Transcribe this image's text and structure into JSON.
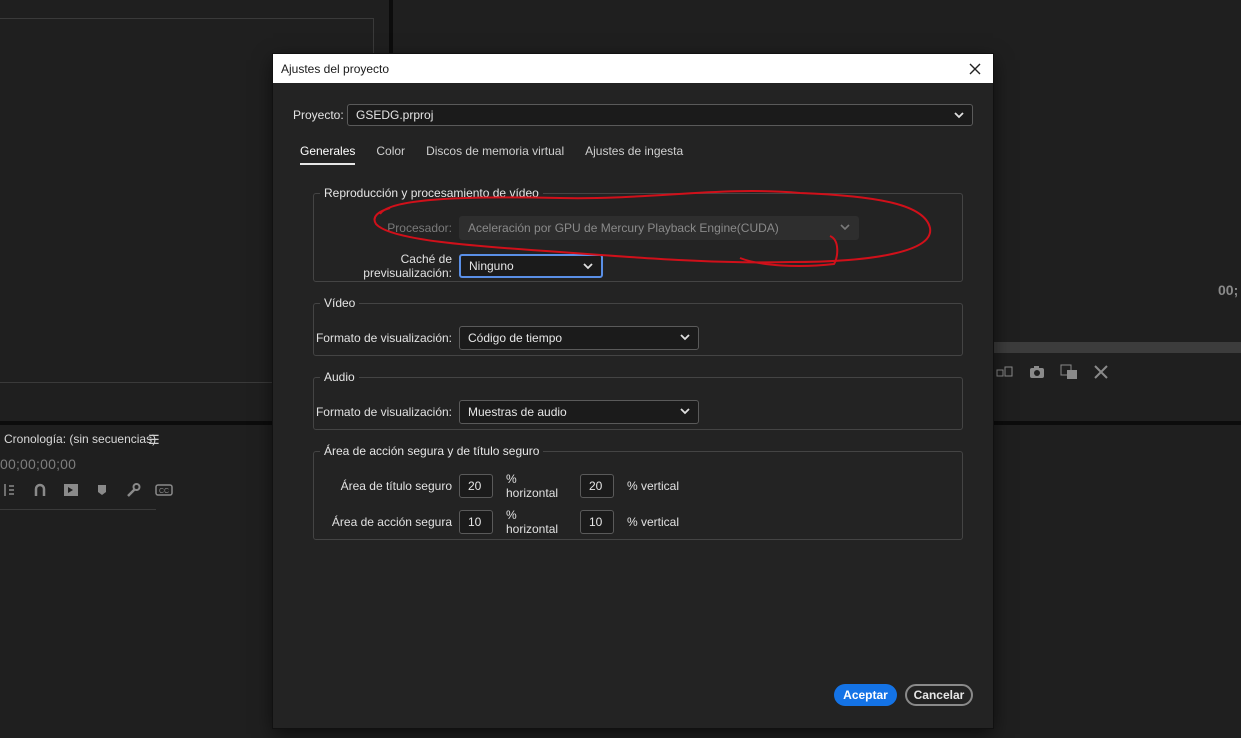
{
  "background": {
    "timecode_right": "00;",
    "timeline_title": "Cronología: (sin secuencias)",
    "timeline_timecode": "00;00;00;00",
    "icons_right": [
      "insert-clip-icon",
      "camera-icon",
      "compare-view-icon",
      "settings-wrench-icon"
    ],
    "timeline_tools": [
      "ripple-edit-icon",
      "snap-magnet-icon",
      "linked-selection-icon",
      "marker-icon",
      "wrench-icon",
      "captions-icon"
    ]
  },
  "dialog": {
    "title": "Ajustes del proyecto",
    "project_label": "Proyecto:",
    "project_value": "GSEDG.prproj",
    "tabs": [
      {
        "label": "Generales",
        "active": true
      },
      {
        "label": "Color",
        "active": false
      },
      {
        "label": "Discos de memoria virtual",
        "active": false
      },
      {
        "label": "Ajustes de ingesta",
        "active": false
      }
    ],
    "groups": {
      "playback": {
        "legend": "Reproducción y procesamiento de vídeo",
        "renderer_label": "Procesador:",
        "renderer_value": "Aceleración por GPU de Mercury Playback Engine(CUDA)",
        "cache_label": "Caché de previsualización:",
        "cache_value": "Ninguno"
      },
      "video": {
        "legend": "Vídeo",
        "format_label": "Formato de visualización:",
        "format_value": "Código de tiempo"
      },
      "audio": {
        "legend": "Audio",
        "format_label": "Formato de visualización:",
        "format_value": "Muestras de audio"
      },
      "safe": {
        "legend": "Área de acción segura y de título seguro",
        "title_label": "Área de título seguro",
        "title_h": "20",
        "title_v": "20",
        "action_label": "Área de acción segura",
        "action_h": "10",
        "action_v": "10",
        "unit_h": "% horizontal",
        "unit_v": "% vertical"
      }
    },
    "buttons": {
      "ok": "Aceptar",
      "cancel": "Cancelar"
    }
  },
  "colors": {
    "accent": "#1473e6",
    "focus": "#5a8fe6",
    "annotation": "#d0101a"
  }
}
